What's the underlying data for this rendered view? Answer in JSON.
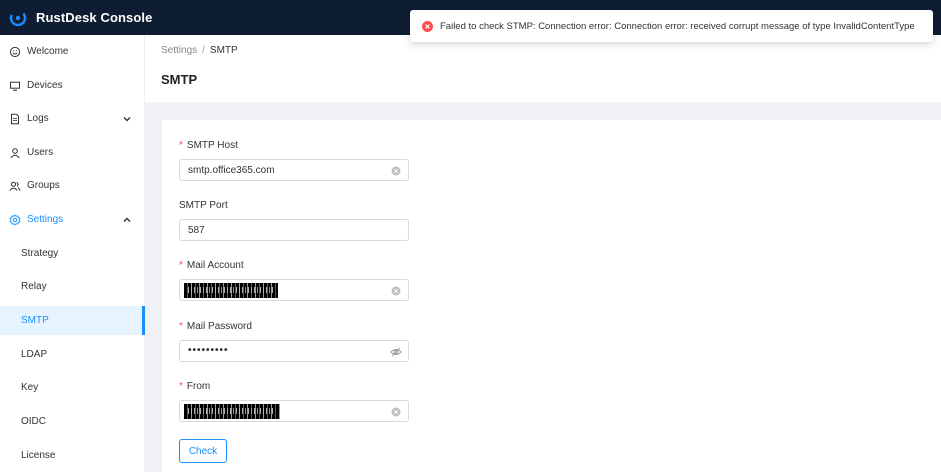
{
  "app": {
    "title": "RustDesk Console"
  },
  "sidebar": {
    "items": [
      {
        "label": "Welcome",
        "icon": "smile-icon"
      },
      {
        "label": "Devices",
        "icon": "monitor-icon"
      },
      {
        "label": "Logs",
        "icon": "file-icon"
      },
      {
        "label": "Users",
        "icon": "user-icon"
      },
      {
        "label": "Groups",
        "icon": "team-icon"
      },
      {
        "label": "Settings",
        "icon": "gear-icon"
      }
    ],
    "settings_children": [
      "Strategy",
      "Relay",
      "SMTP",
      "LDAP",
      "Key",
      "OIDC",
      "License"
    ],
    "selected": "SMTP"
  },
  "breadcrumb": {
    "parent": "Settings",
    "current": "SMTP"
  },
  "page": {
    "title": "SMTP"
  },
  "form": {
    "smtp_host": {
      "label": "SMTP Host",
      "value": "smtp.office365.com"
    },
    "smtp_port": {
      "label": "SMTP Port",
      "value": "587"
    },
    "mail_account": {
      "label": "Mail Account"
    },
    "mail_password": {
      "label": "Mail Password",
      "value": "•••••••••"
    },
    "from": {
      "label": "From"
    },
    "check_button": "Check"
  },
  "toast": {
    "message": "Failed to check STMP: Connection error: Connection error: received corrupt message of type InvalidContentType"
  },
  "colors": {
    "header": "#0f1d33",
    "accent": "#1890ff",
    "error": "#ff4d4f"
  }
}
